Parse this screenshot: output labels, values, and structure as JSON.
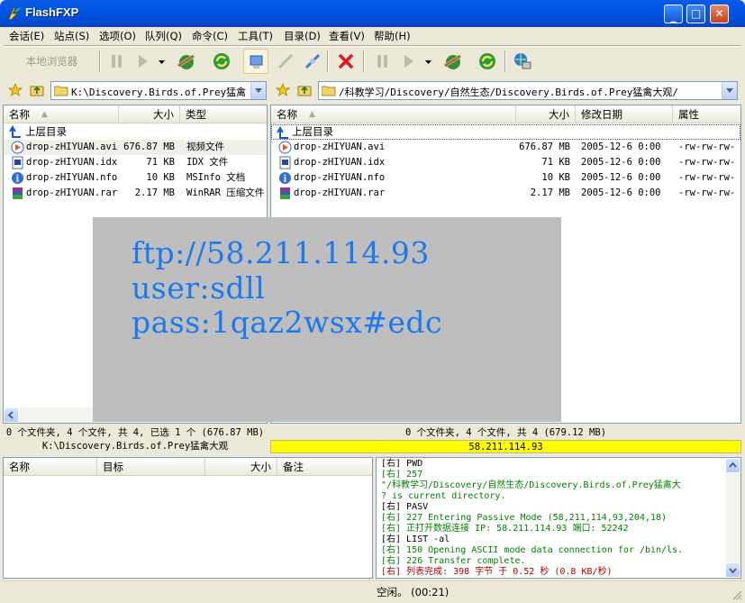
{
  "window": {
    "title": "FlashFXP"
  },
  "menu": [
    "会话(E)",
    "站点(S)",
    "选项(O)",
    "队列(Q)",
    "命令(C)",
    "工具(T)",
    "目录(D)",
    "查看(V)",
    "帮助(H)"
  ],
  "toolbar": {
    "local_browser_label": "本地浏览器"
  },
  "local": {
    "path": "K:\\Discovery.Birds.of.Prey猛禽大",
    "columns": [
      "名称",
      "大小",
      "类型"
    ],
    "parent_label": "上层目录",
    "files": [
      {
        "name": "drop-zHIYUAN.avi",
        "size": "676.87 MB",
        "type": "视频文件",
        "icon": "video-file-icon"
      },
      {
        "name": "drop-zHIYUAN.idx",
        "size": "71 KB",
        "type": "IDX 文件",
        "icon": "idx-file-icon"
      },
      {
        "name": "drop-zHIYUAN.nfo",
        "size": "10 KB",
        "type": "MSInfo 文档",
        "icon": "info-file-icon"
      },
      {
        "name": "drop-zHIYUAN.rar",
        "size": "2.17 MB",
        "type": "WinRAR 压缩文件",
        "icon": "rar-file-icon"
      }
    ],
    "summary": "0 个文件夹, 4 个文件, 共 4, 已选 1 个 (676.87 MB)",
    "path_status": "K:\\Discovery.Birds.of.Prey猛禽大观"
  },
  "remote": {
    "path": "/科教学习/Discovery/自然生态/Discovery.Birds.of.Prey猛禽大观/",
    "columns": [
      "名称",
      "大小",
      "修改日期",
      "属性"
    ],
    "parent_label": "上层目录",
    "files": [
      {
        "name": "drop-zHIYUAN.avi",
        "size": "676.87 MB",
        "date": "2005-12-6 0:00",
        "attr": "-rw-rw-rw-",
        "icon": "video-file-icon"
      },
      {
        "name": "drop-zHIYUAN.idx",
        "size": "71 KB",
        "date": "2005-12-6 0:00",
        "attr": "-rw-rw-rw-",
        "icon": "idx-file-icon"
      },
      {
        "name": "drop-zHIYUAN.nfo",
        "size": "10 KB",
        "date": "2005-12-6 0:00",
        "attr": "-rw-rw-rw-",
        "icon": "info-file-icon"
      },
      {
        "name": "drop-zHIYUAN.rar",
        "size": "2.17 MB",
        "date": "2005-12-6 0:00",
        "attr": "-rw-rw-rw-",
        "icon": "rar-file-icon"
      }
    ],
    "summary": "0 个文件夹, 4 个文件, 共 4 (679.12 MB)",
    "host_status": "58.211.114.93",
    "host_status_bg": "#ffff00"
  },
  "queue": {
    "columns": [
      "名称",
      "目标",
      "大小",
      "备注"
    ]
  },
  "log": {
    "color": "#008000",
    "lines": [
      "[右] PWD",
      "[右] 257",
      "\"/科教学习/Discovery/自然生态/Discovery.Birds.of.Prey猛禽大",
      "? is current directory.",
      "[右] PASV",
      "[右] 227 Entering Passive Mode (58,211,114,93,204,18)",
      "[右] 正打开数据连接 IP: 58.211.114.93 端口: 52242",
      "[右] LIST -al",
      "[右] 150 Opening ASCII mode data connection for /bin/ls.",
      "[右] 226 Transfer complete.",
      "[右] 列表完成: 398 字节 于 0.52 秒 (0.8 KB/秒)"
    ]
  },
  "statusbar": {
    "text": "空闲。 (00:21)"
  },
  "overlay": {
    "lines": [
      "ftp://58.211.114.93",
      "user:sdll",
      "pass:1qaz2wsx#edc"
    ],
    "text_color": "#1b7af0",
    "bg_color": "#bebebe"
  }
}
